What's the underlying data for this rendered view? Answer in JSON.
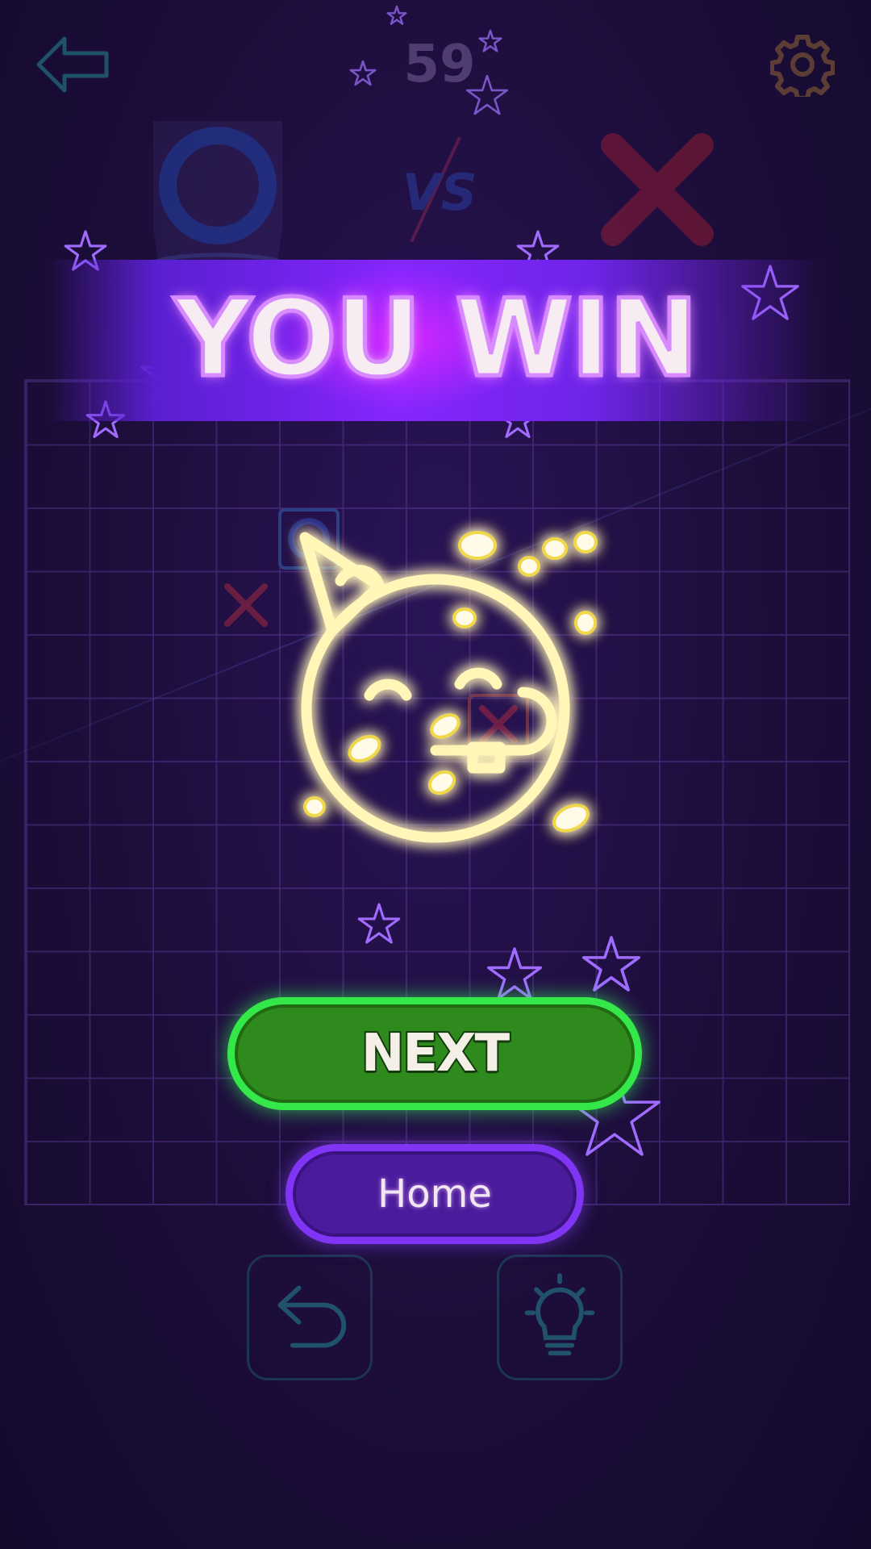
{
  "header": {
    "timer": "59",
    "back_icon": "back-arrow-icon",
    "settings_icon": "gear-icon"
  },
  "players": {
    "left": "O",
    "vs_label": "VS",
    "right": "X"
  },
  "board": {
    "size": 16
  },
  "result": {
    "title": "YOU WIN",
    "emoji_icon": "party-face-icon"
  },
  "buttons": {
    "next_label": "NEXT",
    "home_label": "Home",
    "undo_icon": "undo-icon",
    "hint_icon": "lightbulb-icon"
  },
  "colors": {
    "background": "#1f0f40",
    "banner": "#8526ff",
    "title_text": "#f7ecf2",
    "next_button": "#2e8a1c",
    "next_border": "#35e84a",
    "home_button": "#4a1b9c",
    "home_border": "#7f35f3",
    "emoji_glow": "#fff36a"
  }
}
